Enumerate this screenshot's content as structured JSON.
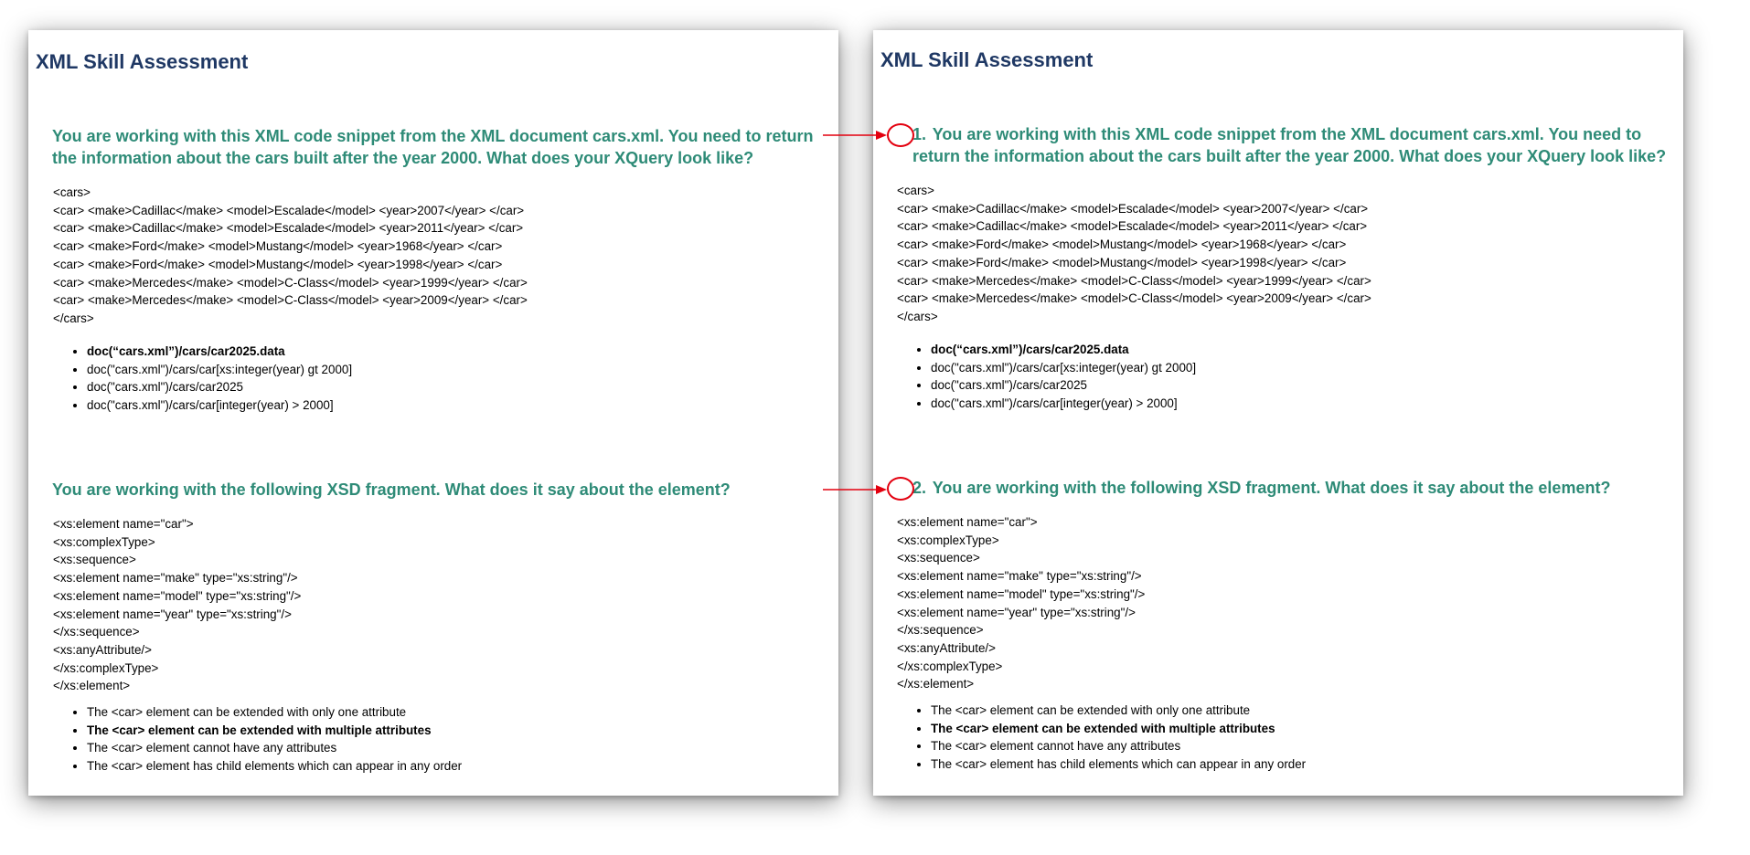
{
  "page_title": "XML Skill Assessment",
  "questions": [
    {
      "number": "1.",
      "text": "You are working with this XML code snippet from the XML document cars.xml. You need to return the information about the cars built after the year 2000. What does your XQuery look like?",
      "code": "<cars>\n<car> <make>Cadillac</make> <model>Escalade</model> <year>2007</year> </car>\n<car> <make>Cadillac</make> <model>Escalade</model> <year>2011</year> </car>\n<car> <make>Ford</make> <model>Mustang</model> <year>1968</year> </car>\n<car> <make>Ford</make> <model>Mustang</model> <year>1998</year> </car>\n<car> <make>Mercedes</make> <model>C-Class</model> <year>1999</year> </car>\n<car> <make>Mercedes</make> <model>C-Class</model> <year>2009</year> </car>\n</cars>",
      "options": [
        "doc(“cars.xml”)/cars/car2025.data",
        "doc(\"cars.xml\")/cars/car[xs:integer(year) gt 2000]",
        "doc(\"cars.xml\")/cars/car2025",
        "doc(\"cars.xml\")/cars/car[integer(year) > 2000]"
      ],
      "highlighted_option": 0
    },
    {
      "number": "2.",
      "text": "You are working with the following XSD fragment. What does it say about the element?",
      "code": "<xs:element name=\"car\">\n<xs:complexType>\n<xs:sequence>\n<xs:element name=\"make\" type=\"xs:string\"/>\n<xs:element name=\"model\" type=\"xs:string\"/>\n<xs:element name=\"year\" type=\"xs:string\"/>\n</xs:sequence>\n<xs:anyAttribute/>\n</xs:complexType>\n</xs:element>",
      "options": [
        "The <car> element can be extended with only one attribute",
        "The <car> element can be extended with multiple attributes",
        "The <car> element cannot have any attributes",
        "The <car> element has child elements which can appear in any order"
      ],
      "highlighted_option": 1
    }
  ],
  "colors": {
    "title": "#1f3864",
    "question": "#2e8b77",
    "annotation": "#e3000f"
  }
}
